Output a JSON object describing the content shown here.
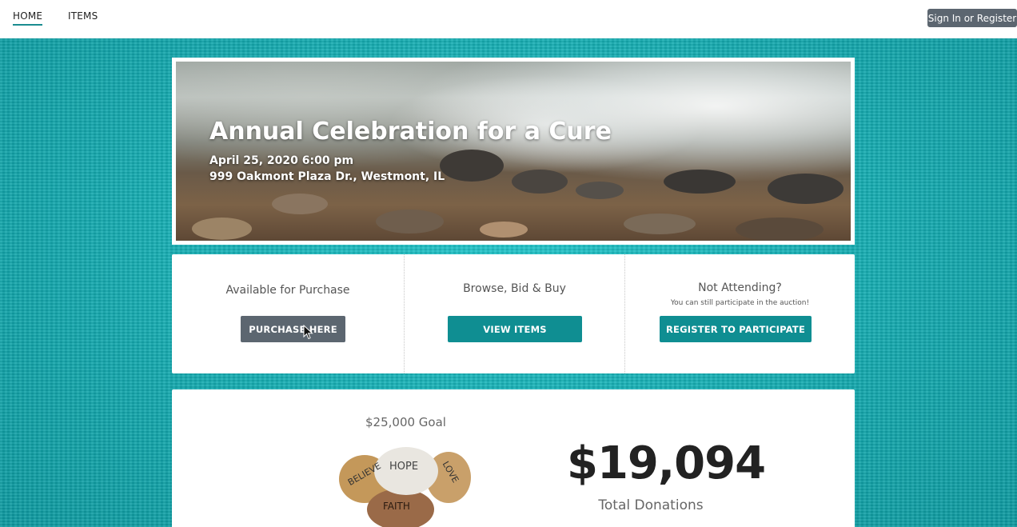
{
  "nav": {
    "home_label": "HOME",
    "items_label": "ITEMS",
    "signin_label": "Sign In or Register"
  },
  "event": {
    "title": "Annual Celebration for a Cure",
    "datetime": "April 25, 2020 6:00 pm",
    "address": "999 Oakmont Plaza Dr., Westmont, IL"
  },
  "actions": {
    "purchase": {
      "heading": "Available for Purchase",
      "button": "PURCHASE HERE"
    },
    "browse": {
      "heading": "Browse, Bid & Buy",
      "button": "VIEW ITEMS"
    },
    "register": {
      "heading": "Not Attending?",
      "note": "You can still participate in the auction!",
      "button": "REGISTER TO PARTICIPATE"
    }
  },
  "donations": {
    "goal": "$25,000 Goal",
    "amount": "$19,094",
    "label": "Total Donations",
    "stone_words": [
      "BELIEVE",
      "HOPE",
      "LOVE",
      "FAITH"
    ]
  },
  "colors": {
    "accent_teal": "#0f8e92",
    "button_gray": "#5c6670",
    "background_teal": "#17b4b8"
  }
}
